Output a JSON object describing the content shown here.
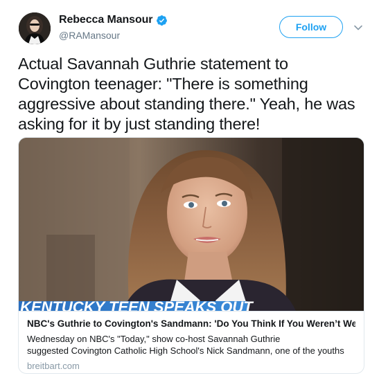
{
  "author": {
    "display_name": "Rebecca Mansour",
    "handle": "@RAMansour",
    "verified": true
  },
  "actions": {
    "follow_label": "Follow"
  },
  "tweet": {
    "text": "Actual Savannah Guthrie statement to Covington teenager: \"There is something aggressive about standing there.\" Yeah, he was asking for it by just standing there!"
  },
  "card": {
    "chyron": "KENTUCKY TEEN SPEAKS OUT",
    "title": "NBC's Guthrie to Covington's Sandmann: 'Do You Think If You Weren’t Weari...",
    "description_line1": "Wednesday on NBC's \"Today,\" show co-host Savannah Guthrie",
    "description_line2": "suggested Covington Catholic High School's Nick Sandmann, one of the youths",
    "domain": "breitbart.com"
  },
  "colors": {
    "brand_blue": "#1da1f2",
    "verified_blue": "#1da1f2",
    "muted_text": "#657786",
    "border": "#e1e8ed",
    "chyron_blue": "#2a73c8"
  },
  "icons": {
    "verified": "verified-badge-icon",
    "caret": "chevron-down-icon"
  }
}
